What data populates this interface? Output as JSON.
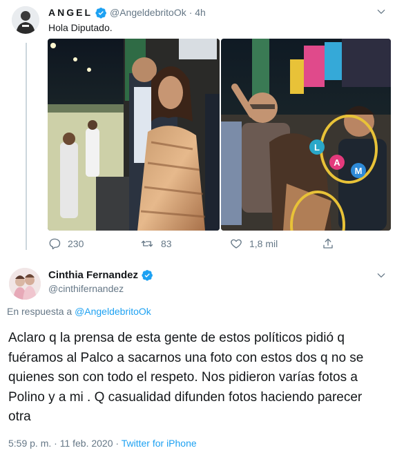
{
  "tweet1": {
    "display_name": "ANGEL",
    "handle": "@AngeldebritoOk",
    "time": "· 4h",
    "text": "Hola Diputado.",
    "photo_overlay_letters": [
      "L",
      "A",
      "M"
    ],
    "actions": {
      "replies": "230",
      "retweets": "83",
      "likes": "1,8 mil"
    }
  },
  "tweet2": {
    "display_name": "Cinthia Fernandez",
    "handle": "@cinthifernandez",
    "reply_prefix": "En respuesta a",
    "reply_to": "@AngeldebritoOk",
    "text": "Aclaro q la prensa de esta gente de estos políticos pidió q fuéramos al Palco a sacarnos una foto con estos dos q no se quienes son con todo el respeto. Nos pidieron varías fotos a Polino y a mi . Q casualidad difunden fotos haciendo parecer otra",
    "timestamp": "5:59 p. m. · 11 feb. 2020",
    "source": "Twitter for iPhone"
  },
  "colors": {
    "accent": "#1da1f2",
    "muted": "#657786",
    "lam_L": "#2aa7c8",
    "lam_A": "#e33a7c",
    "lam_M": "#2e8ad6"
  }
}
